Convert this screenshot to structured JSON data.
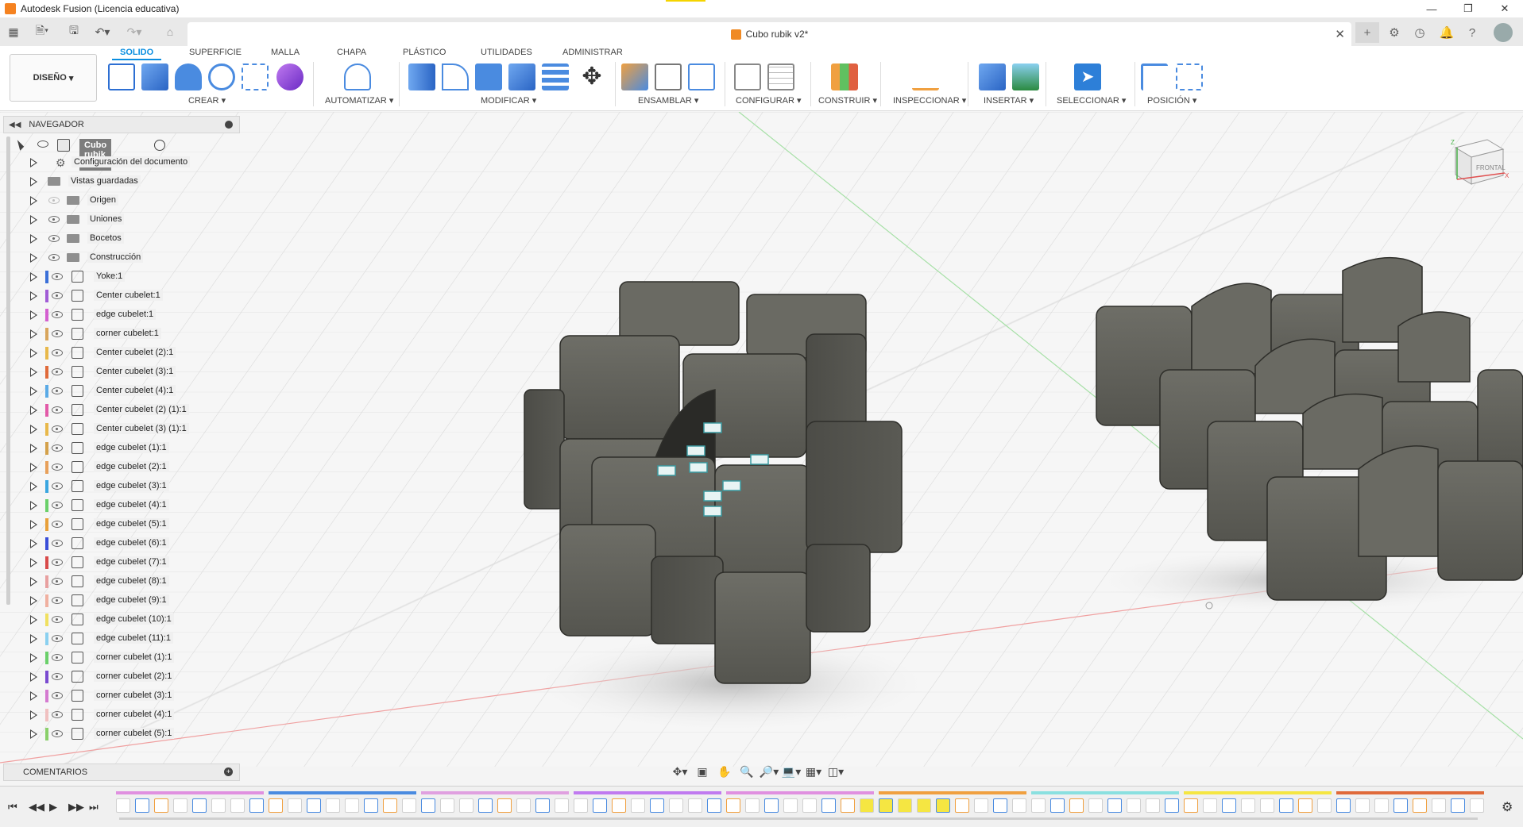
{
  "window": {
    "title": "Autodesk Fusion (Licencia educativa)"
  },
  "document": {
    "tab_title": "Cubo rubik v2*"
  },
  "ribbon": {
    "workspace": "DISEÑO",
    "tabs": [
      "SOLIDO",
      "SUPERFICIE",
      "MALLA",
      "CHAPA",
      "PLÁSTICO",
      "UTILIDADES",
      "ADMINISTRAR"
    ],
    "active_tab": "SOLIDO",
    "groups": [
      "CREAR",
      "AUTOMATIZAR",
      "MODIFICAR",
      "ENSAMBLAR",
      "CONFIGURAR",
      "CONSTRUIR",
      "INSPECCIONAR",
      "INSERTAR",
      "SELECCIONAR",
      "POSICIÓN"
    ]
  },
  "browser": {
    "title": "NAVEGADOR",
    "root": "Cubo rubik v2",
    "items": [
      {
        "label": "Configuración del documento",
        "icon": "gear-icon",
        "color": ""
      },
      {
        "label": "Vistas guardadas",
        "icon": "folder-icon",
        "color": ""
      },
      {
        "label": "Origen",
        "icon": "folder-icon",
        "color": "",
        "hidden": true
      },
      {
        "label": "Uniones",
        "icon": "folder-icon",
        "color": ""
      },
      {
        "label": "Bocetos",
        "icon": "folder-icon",
        "color": ""
      },
      {
        "label": "Construcción",
        "icon": "folder-icon",
        "color": ""
      },
      {
        "label": "Yoke:1",
        "icon": "component-icon",
        "color": "#3a6fd8"
      },
      {
        "label": "Center cubelet:1",
        "icon": "component-icon",
        "color": "#a15cd6"
      },
      {
        "label": "edge cubelet:1",
        "icon": "component-icon",
        "color": "#d45fd0"
      },
      {
        "label": "corner cubelet:1",
        "icon": "component-icon",
        "color": "#d8a55c"
      },
      {
        "label": "Center cubelet (2):1",
        "icon": "component-icon",
        "color": "#e8b84a"
      },
      {
        "label": "Center cubelet (3):1",
        "icon": "component-icon",
        "color": "#e06a3a"
      },
      {
        "label": "Center cubelet (4):1",
        "icon": "component-icon",
        "color": "#5aaae6"
      },
      {
        "label": "Center cubelet (2) (1):1",
        "icon": "component-icon",
        "color": "#e25aa8"
      },
      {
        "label": "Center cubelet (3) (1):1",
        "icon": "component-icon",
        "color": "#e8b84a"
      },
      {
        "label": "edge cubelet (1):1",
        "icon": "component-icon",
        "color": "#d4a14a"
      },
      {
        "label": "edge cubelet (2):1",
        "icon": "component-icon",
        "color": "#e8a05a"
      },
      {
        "label": "edge cubelet (3):1",
        "icon": "component-icon",
        "color": "#3aa6e0"
      },
      {
        "label": "edge cubelet (4):1",
        "icon": "component-icon",
        "color": "#6ad06a"
      },
      {
        "label": "edge cubelet (5):1",
        "icon": "component-icon",
        "color": "#e8a03a"
      },
      {
        "label": "edge cubelet (6):1",
        "icon": "component-icon",
        "color": "#3a4ed8"
      },
      {
        "label": "edge cubelet (7):1",
        "icon": "component-icon",
        "color": "#d84a4a"
      },
      {
        "label": "edge cubelet (8):1",
        "icon": "component-icon",
        "color": "#e8a0a0"
      },
      {
        "label": "edge cubelet (9):1",
        "icon": "component-icon",
        "color": "#f0b0a0"
      },
      {
        "label": "edge cubelet (10):1",
        "icon": "component-icon",
        "color": "#f0e060"
      },
      {
        "label": "edge cubelet (11):1",
        "icon": "component-icon",
        "color": "#8ad0f0"
      },
      {
        "label": "corner cubelet (1):1",
        "icon": "component-icon",
        "color": "#6ad06a"
      },
      {
        "label": "corner cubelet (2):1",
        "icon": "component-icon",
        "color": "#7a4ad0"
      },
      {
        "label": "corner cubelet (3):1",
        "icon": "component-icon",
        "color": "#d47ad0"
      },
      {
        "label": "corner cubelet (4):1",
        "icon": "component-icon",
        "color": "#f0c0c0"
      },
      {
        "label": "corner cubelet (5):1",
        "icon": "component-icon",
        "color": "#8ad06a"
      }
    ]
  },
  "comments": {
    "title": "COMENTARIOS"
  },
  "viewcube": {
    "label": "FRONTAL",
    "axis_x": "X",
    "axis_z": "Z"
  },
  "colors": {
    "accent": "#0a8ee0",
    "model": "#5e5e57",
    "timeline_highlight": "#f5e642"
  }
}
